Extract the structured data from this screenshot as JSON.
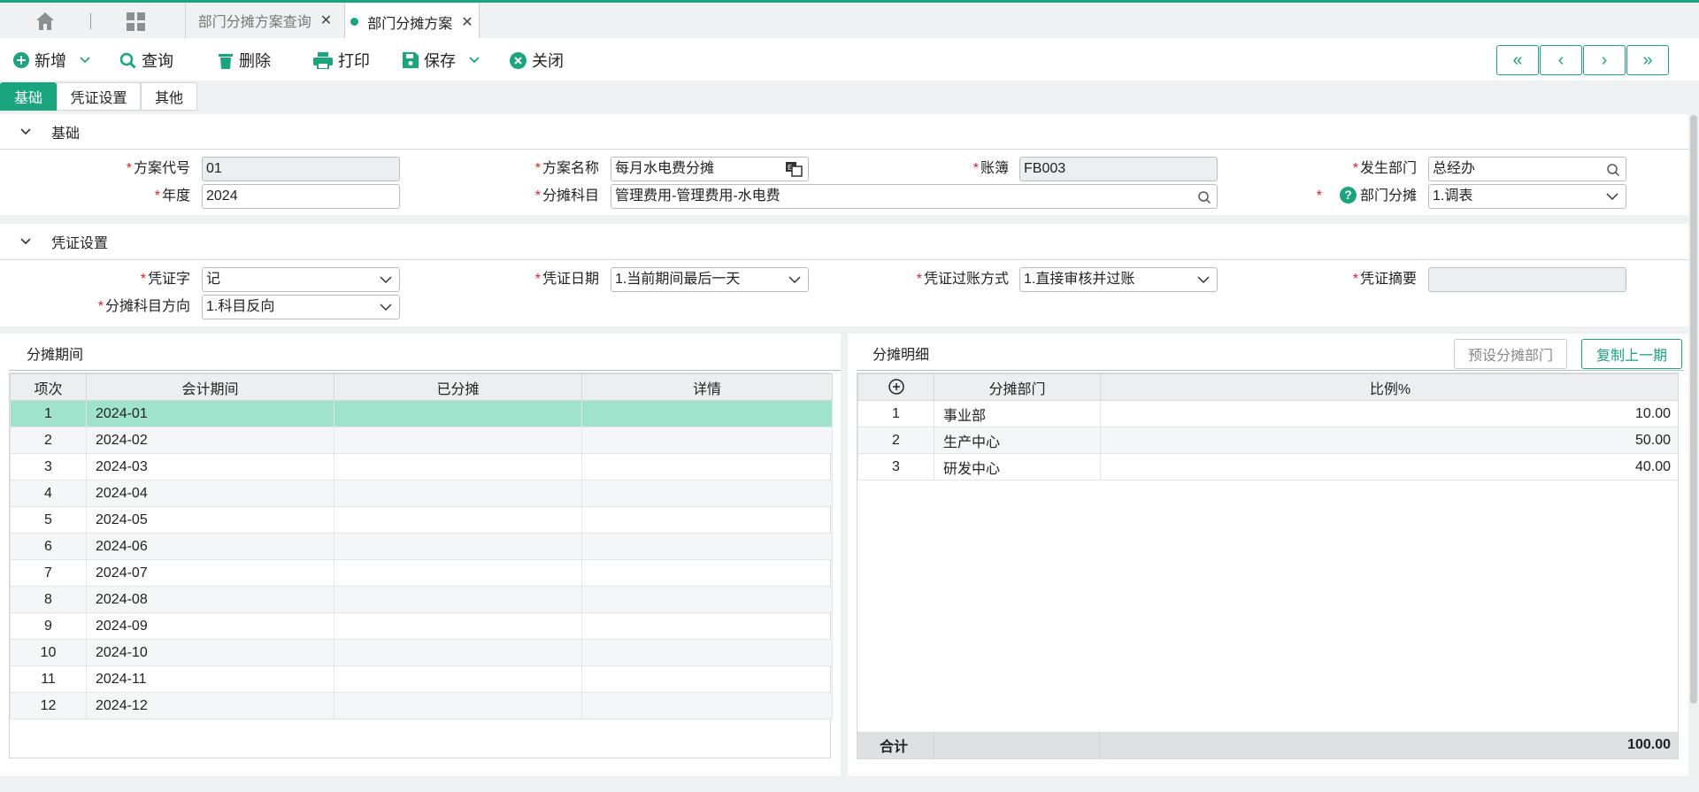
{
  "tabs": {
    "query_tab": "部门分摊方案查询",
    "active_tab": "部门分摊方案"
  },
  "toolbar": {
    "new_label": "新增",
    "query_label": "查询",
    "delete_label": "删除",
    "print_label": "打印",
    "save_label": "保存",
    "close_label": "关闭",
    "nav": [
      "«",
      "‹",
      "›",
      "»"
    ]
  },
  "subtabs": [
    "基础",
    "凭证设置",
    "其他"
  ],
  "basic": {
    "title": "基础",
    "plan_code_label": "方案代号",
    "plan_code": "01",
    "plan_name_label": "方案名称",
    "plan_name": "每月水电费分摊",
    "ledger_label": "账簿",
    "ledger": "FB003",
    "origin_dept_label": "发生部门",
    "origin_dept": "总经办",
    "year_label": "年度",
    "year": "2024",
    "account_label": "分摊科目",
    "account": "管理费用-管理费用-水电费",
    "dept_alloc_label": "部门分摊",
    "dept_alloc": "1.调表"
  },
  "voucher": {
    "title": "凭证设置",
    "word_label": "凭证字",
    "word": "记",
    "date_label": "凭证日期",
    "date": "1.当前期间最后一天",
    "posting_label": "凭证过账方式",
    "posting": "1.直接审核并过账",
    "summary_label": "凭证摘要",
    "summary": "",
    "direction_label": "分摊科目方向",
    "direction": "1.科目反向"
  },
  "periods": {
    "title": "分摊期间",
    "headers": [
      "项次",
      "会计期间",
      "已分摊",
      "详情"
    ],
    "rows": [
      [
        "1",
        "2024-01",
        "",
        ""
      ],
      [
        "2",
        "2024-02",
        "",
        ""
      ],
      [
        "3",
        "2024-03",
        "",
        ""
      ],
      [
        "4",
        "2024-04",
        "",
        ""
      ],
      [
        "5",
        "2024-05",
        "",
        ""
      ],
      [
        "6",
        "2024-06",
        "",
        ""
      ],
      [
        "7",
        "2024-07",
        "",
        ""
      ],
      [
        "8",
        "2024-08",
        "",
        ""
      ],
      [
        "9",
        "2024-09",
        "",
        ""
      ],
      [
        "10",
        "2024-10",
        "",
        ""
      ],
      [
        "11",
        "2024-11",
        "",
        ""
      ],
      [
        "12",
        "2024-12",
        "",
        ""
      ]
    ]
  },
  "details": {
    "title": "分摊明细",
    "preset_btn": "预设分摊部门",
    "copy_btn": "复制上一期",
    "headers": [
      "",
      "分摊部门",
      "比例%"
    ],
    "rows": [
      [
        "1",
        "事业部",
        "10.00"
      ],
      [
        "2",
        "生产中心",
        "50.00"
      ],
      [
        "3",
        "研发中心",
        "40.00"
      ]
    ],
    "total_label": "合计",
    "total": "100.00"
  },
  "colors": {
    "accent": "#1aa57f",
    "selected_row": "#9fe3cc",
    "required": "#e02020"
  }
}
